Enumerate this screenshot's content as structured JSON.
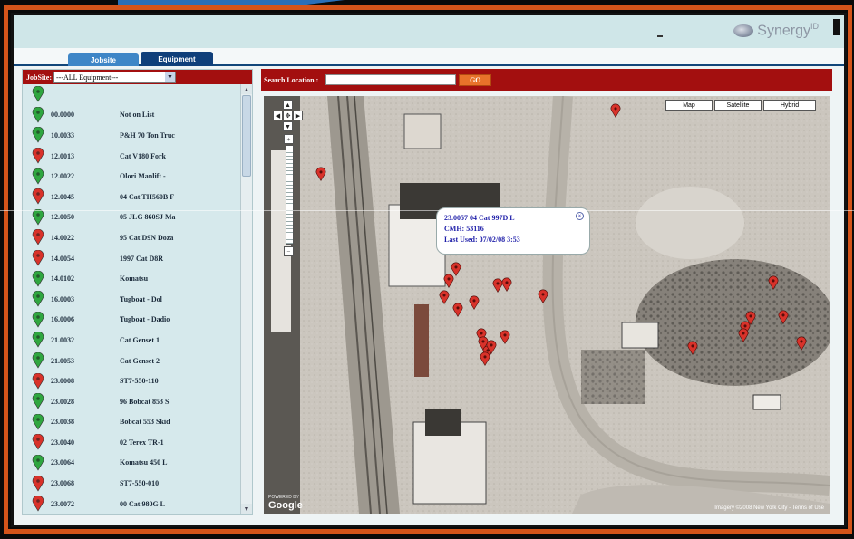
{
  "brand": {
    "name": "Synergy",
    "sup": "ID"
  },
  "tabs": [
    {
      "label": "Jobsite"
    },
    {
      "label": "Equipment"
    }
  ],
  "left_panel": {
    "jobsite_label": "JobSite:",
    "jobsite_select_value": "---ALL Equipment---"
  },
  "equipment": [
    {
      "id": "",
      "name": "",
      "color": "green"
    },
    {
      "id": "00.0000",
      "name": "Not on List",
      "color": "green"
    },
    {
      "id": "10.0033",
      "name": "P&H 70 Ton Truc",
      "color": "green"
    },
    {
      "id": "12.0013",
      "name": "Cat V180 Fork",
      "color": "red"
    },
    {
      "id": "12.0022",
      "name": "Olori Manlift -",
      "color": "green"
    },
    {
      "id": "12.0045",
      "name": "04 Cat TH560B F",
      "color": "red"
    },
    {
      "id": "12.0050",
      "name": "05 JLG 860SJ Ma",
      "color": "green"
    },
    {
      "id": "14.0022",
      "name": "95 Cat D9N Doza",
      "color": "red"
    },
    {
      "id": "14.0054",
      "name": "1997 Cat D8R",
      "color": "red"
    },
    {
      "id": "14.0102",
      "name": "Komatsu",
      "color": "green"
    },
    {
      "id": "16.0003",
      "name": "Tugboat - Dol",
      "color": "green"
    },
    {
      "id": "16.0006",
      "name": "Tugboat - Dadio",
      "color": "green"
    },
    {
      "id": "21.0032",
      "name": "Cat Genset 1",
      "color": "green"
    },
    {
      "id": "21.0053",
      "name": "Cat Genset 2",
      "color": "green"
    },
    {
      "id": "23.0008",
      "name": "ST7-550-110",
      "color": "red"
    },
    {
      "id": "23.0028",
      "name": "96 Bobcat 853 S",
      "color": "green"
    },
    {
      "id": "23.0038",
      "name": "Bobcat 553 Skid",
      "color": "green"
    },
    {
      "id": "23.0040",
      "name": "02 Terex TR-1",
      "color": "red"
    },
    {
      "id": "23.0064",
      "name": "Komatsu 450 L",
      "color": "green"
    },
    {
      "id": "23.0068",
      "name": "ST7-550-010",
      "color": "red"
    },
    {
      "id": "23.0072",
      "name": "00 Cat 980G L",
      "color": "red"
    }
  ],
  "search": {
    "label": "Search Location :",
    "value": "",
    "go_label": "GO"
  },
  "map": {
    "buttons": [
      "Map",
      "Satellite",
      "Hybrid"
    ],
    "info_window": {
      "line1": "23.0057      04 Cat 997D L",
      "line2": "CMH: 53116",
      "line3": "Last Used: 07/02/08 3:53"
    },
    "logo": "Google",
    "logo_small": "POWERED BY",
    "copyright": "Imagery ©2008 New York City - Terms of Use"
  },
  "colors": {
    "header_red": "#a30f0f",
    "frame_orange": "#d4541a",
    "pin_green": "#2fa640",
    "pin_red": "#d8322a"
  }
}
